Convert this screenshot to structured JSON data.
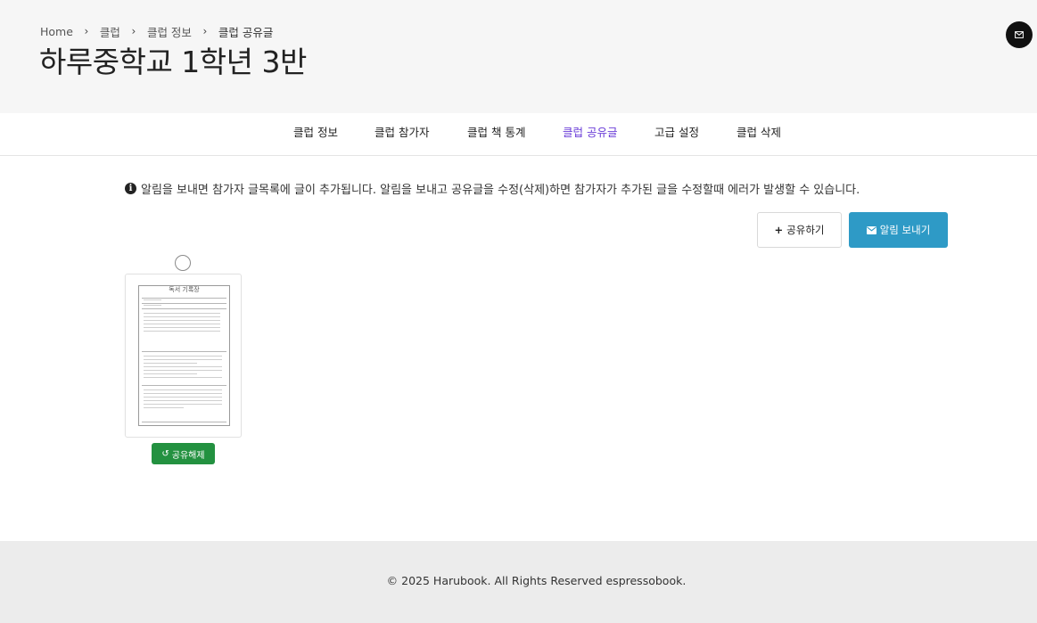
{
  "breadcrumb": {
    "items": [
      "Home",
      "클럽",
      "클럽 정보",
      "클럽 공유글"
    ]
  },
  "header": {
    "title": "하루중학교 1학년 3반",
    "mail_icon": "envelope-icon"
  },
  "tabs": [
    {
      "label": "클럽 정보",
      "active": false
    },
    {
      "label": "클럽 참가자",
      "active": false
    },
    {
      "label": "클럽 책 통계",
      "active": false
    },
    {
      "label": "클럽 공유글",
      "active": true
    },
    {
      "label": "고급 설정",
      "active": false
    },
    {
      "label": "클럽 삭제",
      "active": false
    }
  ],
  "notice": {
    "icon": "info-circle-icon",
    "text": "알림을 보내면 참가자 글목록에 글이 추가됩니다. 알림을 보내고 공유글을 수정(삭제)하면 참가자가 추가된 글을 수정할때 에러가 발생할 수 있습니다."
  },
  "actions": {
    "share_label": "공유하기",
    "share_icon": "plus-icon",
    "notify_label": "알림 보내기",
    "notify_icon": "envelope-icon"
  },
  "posts": [
    {
      "thumbnail_title": "독서 기록장",
      "selected": false,
      "unshare_label": "공유해제",
      "unshare_icon": "undo-icon"
    }
  ],
  "footer": {
    "text": "© 2025 Harubook. All Rights Reserved espressobook."
  },
  "colors": {
    "header_bg": "#f6f6f6",
    "active_tab": "#6a3dd8",
    "notify_button": "#2e9ac6",
    "unshare_button": "#239140",
    "footer_bg": "#ececec"
  }
}
